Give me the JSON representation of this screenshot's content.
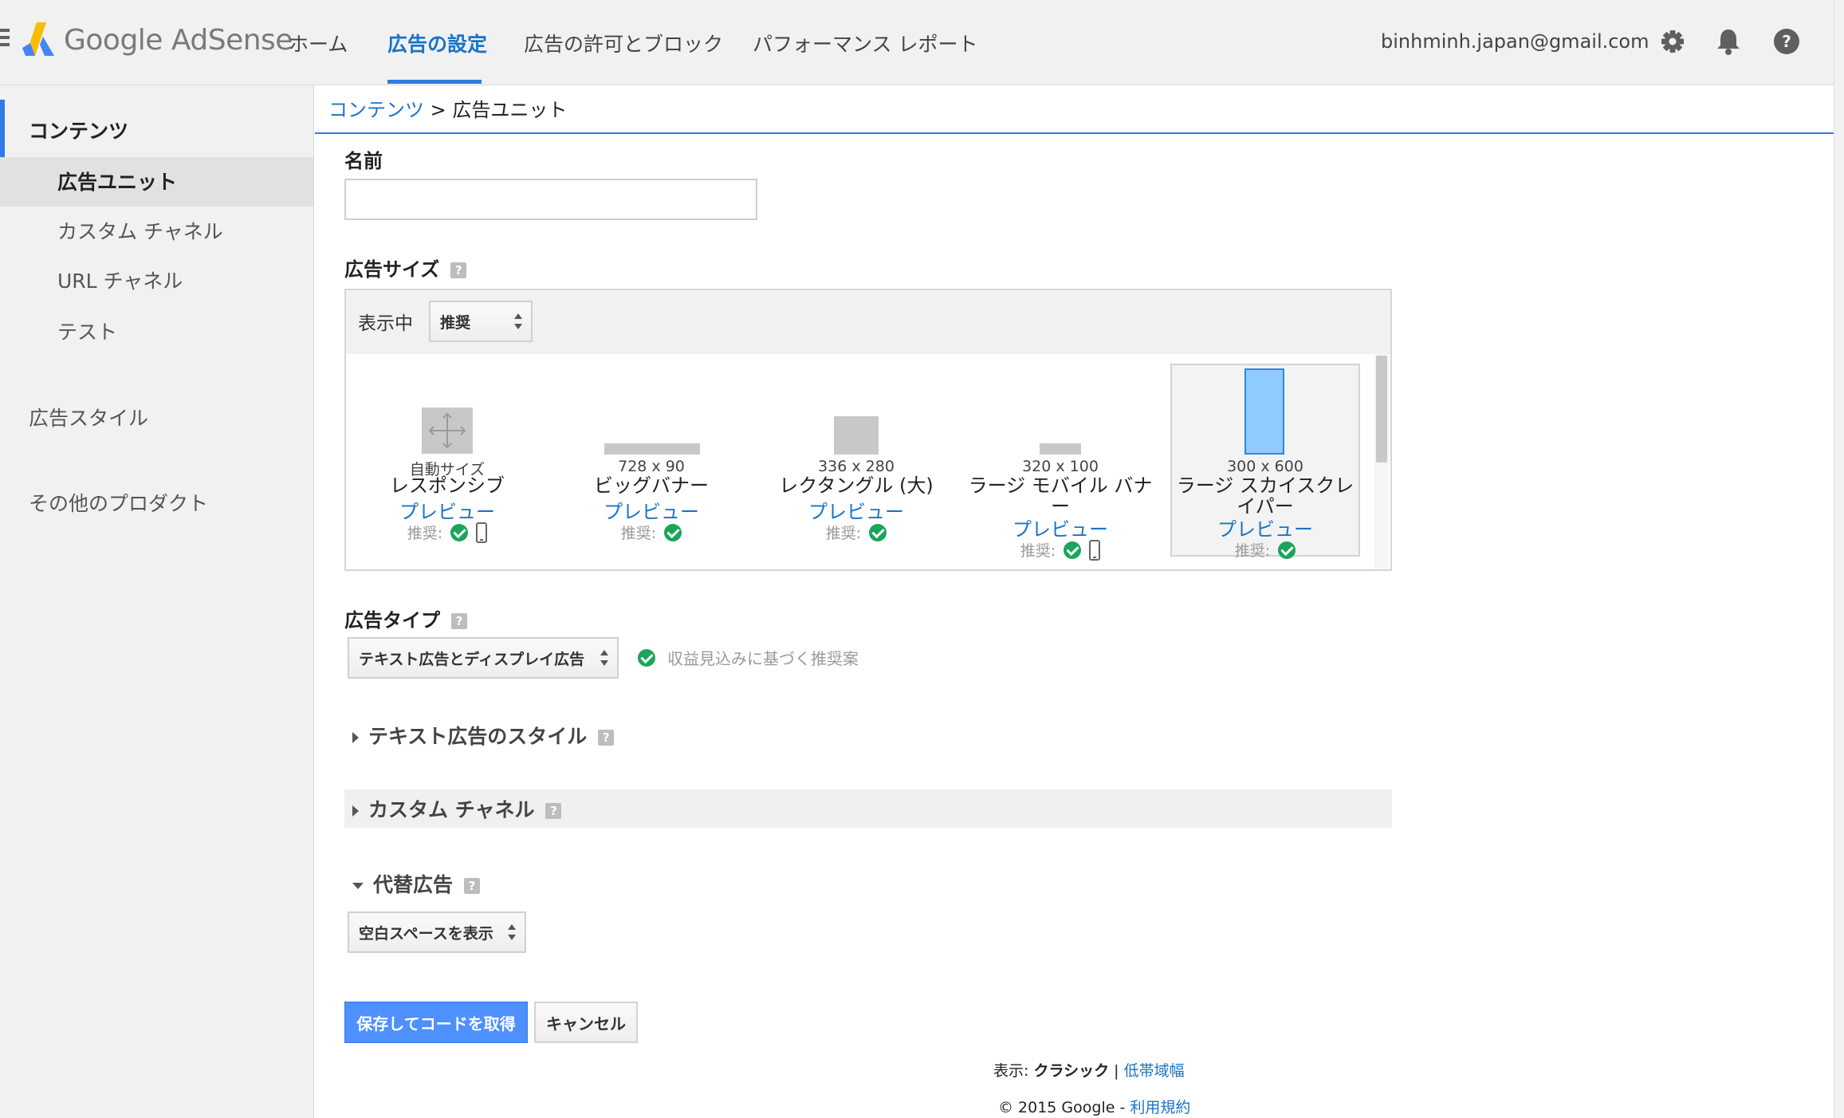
{
  "header": {
    "logo_text": "Google AdSense",
    "nav": [
      "ホーム",
      "広告の設定",
      "広告の許可とブロック",
      "パフォーマンス レポート"
    ],
    "active_nav_index": 1,
    "user_email": "binhminh.japan@gmail.com",
    "icons": [
      "menu-icon",
      "gear-icon",
      "bell-icon",
      "help-icon"
    ]
  },
  "sidebar": {
    "items": [
      {
        "label": "コンテンツ",
        "level": "section",
        "active": true
      },
      {
        "label": "広告ユニット",
        "level": "child",
        "selected": true
      },
      {
        "label": "カスタム チャネル",
        "level": "child"
      },
      {
        "label": "URL チャネル",
        "level": "child"
      },
      {
        "label": "テスト",
        "level": "child"
      },
      {
        "label": "広告スタイル",
        "level": "section"
      },
      {
        "label": "その他のプロダクト",
        "level": "section"
      }
    ]
  },
  "breadcrumb": {
    "link": "コンテンツ",
    "separator": ">",
    "current": "広告ユニット"
  },
  "form": {
    "name_label": "名前",
    "name_value": "",
    "ad_size": {
      "label": "広告サイズ",
      "help": "?",
      "showing_label": "表示中",
      "showing_value": "推奨",
      "options": [
        {
          "dims": "自動サイズ",
          "name": "レスポンシブ",
          "preview": "プレビュー",
          "rec_label": "推奨:",
          "mobile": true,
          "selected": false
        },
        {
          "dims": "728 x 90",
          "name": "ビッグバナー",
          "preview": "プレビュー",
          "rec_label": "推奨:",
          "mobile": false,
          "selected": false
        },
        {
          "dims": "336 x 280",
          "name": "レクタングル (大)",
          "preview": "プレビュー",
          "rec_label": "推奨:",
          "mobile": false,
          "selected": false
        },
        {
          "dims": "320 x 100",
          "name": "ラージ モバイル バナー",
          "preview": "プレビュー",
          "rec_label": "推奨:",
          "mobile": true,
          "selected": false
        },
        {
          "dims": "300 x 600",
          "name": "ラージ スカイスクレイパー",
          "preview": "プレビュー",
          "rec_label": "推奨:",
          "mobile": false,
          "selected": true
        }
      ]
    },
    "ad_type": {
      "label": "広告タイプ",
      "help": "?",
      "value": "テキスト広告とディスプレイ広告",
      "note": "収益見込みに基づく推奨案"
    },
    "text_ad_style": {
      "label": "テキスト広告のスタイル",
      "help": "?",
      "expanded": false
    },
    "custom_channel": {
      "label": "カスタム チャネル",
      "help": "?",
      "expanded": false
    },
    "backfill": {
      "label": "代替広告",
      "help": "?",
      "expanded": true,
      "value": "空白スペースを表示"
    },
    "save_label": "保存してコードを取得",
    "cancel_label": "キャンセル"
  },
  "footer": {
    "view_prefix": "表示:",
    "view_current": "クラシック",
    "view_sep": "|",
    "view_alt": "低帯域幅",
    "copyright": "© 2015 Google -",
    "terms": "利用規約"
  },
  "colors": {
    "accent": "#2f7be5",
    "link": "#1a73c8",
    "check": "#19a55a",
    "primary_button": "#4d90fe",
    "selected_size": "#8fcbff"
  }
}
